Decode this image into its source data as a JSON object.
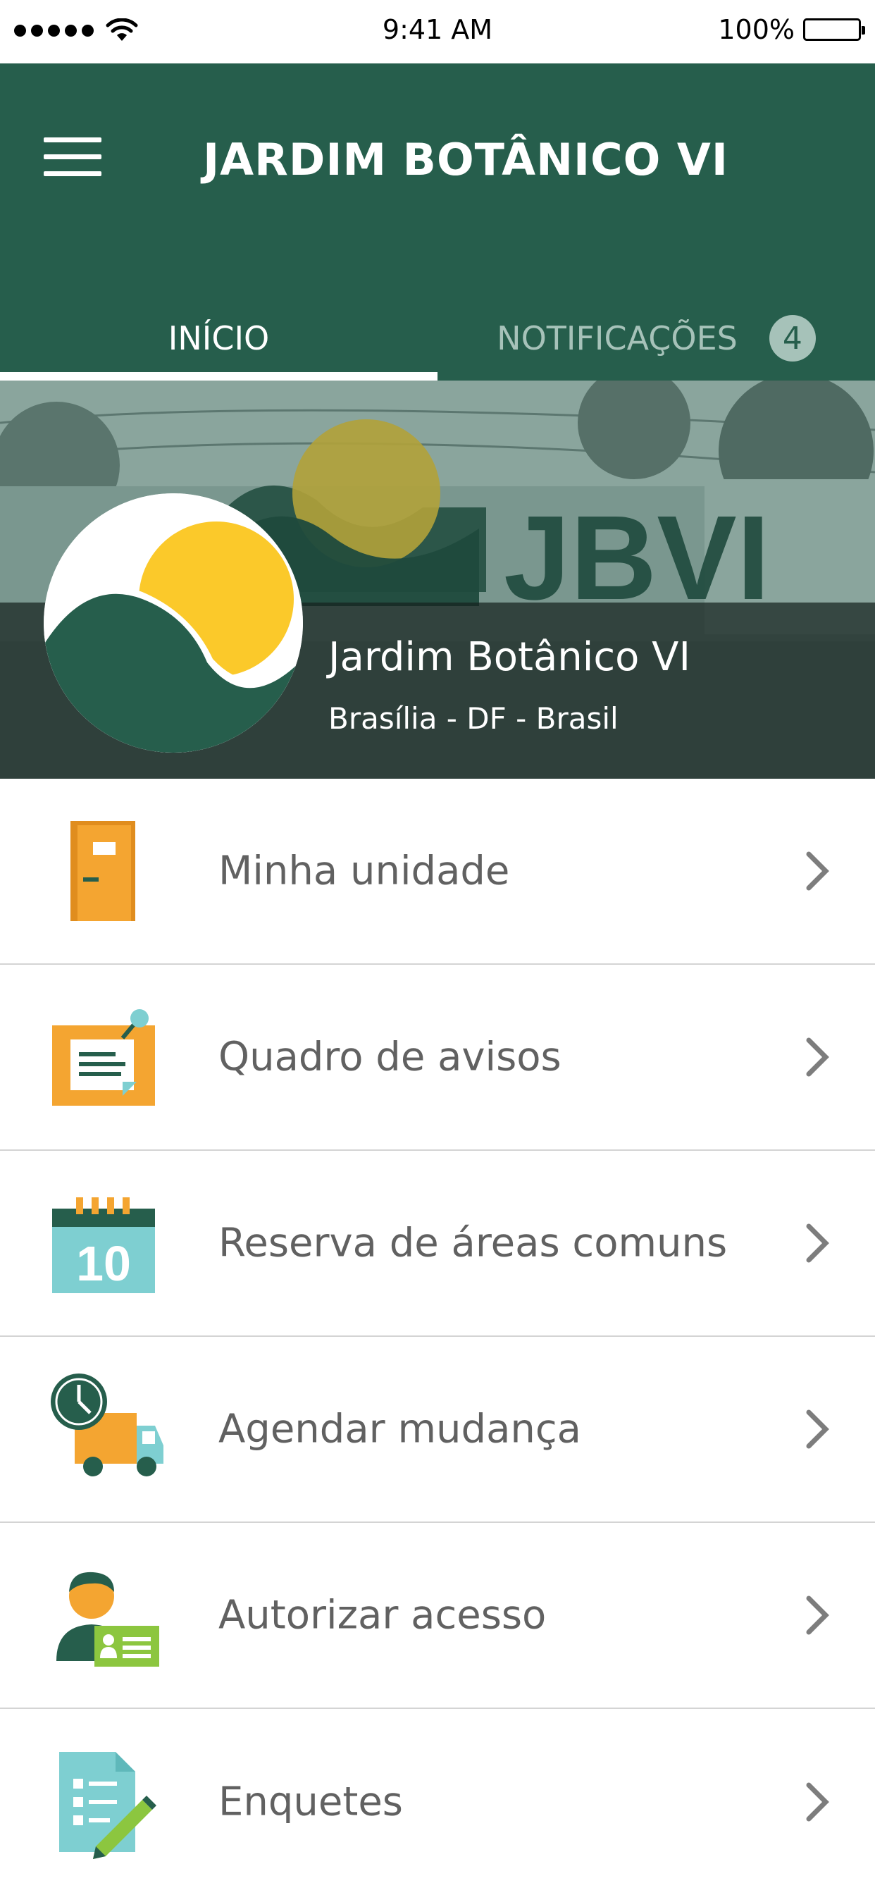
{
  "status_bar": {
    "time": "9:41 AM",
    "battery_percent": "100%",
    "signal_bars": 5
  },
  "header": {
    "title": "JARDIM BOTÂNICO VI",
    "background_color": "#265e4c"
  },
  "tabs": [
    {
      "label": "INÍCIO",
      "active": true
    },
    {
      "label": "NOTIFICAÇÕES",
      "active": false,
      "badge": "4"
    }
  ],
  "hero": {
    "banner_text": "JBVI",
    "name": "Jardim Botânico VI",
    "location": "Brasília - DF - Brasil"
  },
  "menu": [
    {
      "label": "Minha unidade",
      "icon": "door-icon"
    },
    {
      "label": "Quadro de avisos",
      "icon": "notice-board-icon"
    },
    {
      "label": "Reserva de áreas comuns",
      "icon": "calendar-icon",
      "icon_text": "10"
    },
    {
      "label": "Agendar mudança",
      "icon": "moving-truck-icon"
    },
    {
      "label": "Autorizar acesso",
      "icon": "access-card-icon"
    },
    {
      "label": "Enquetes",
      "icon": "poll-icon"
    }
  ],
  "colors": {
    "brand_green": "#265e4c",
    "accent_orange": "#f4a531",
    "accent_teal": "#7ecfd1",
    "accent_yellow": "#fbc92a",
    "accent_lime": "#8cc63f"
  }
}
